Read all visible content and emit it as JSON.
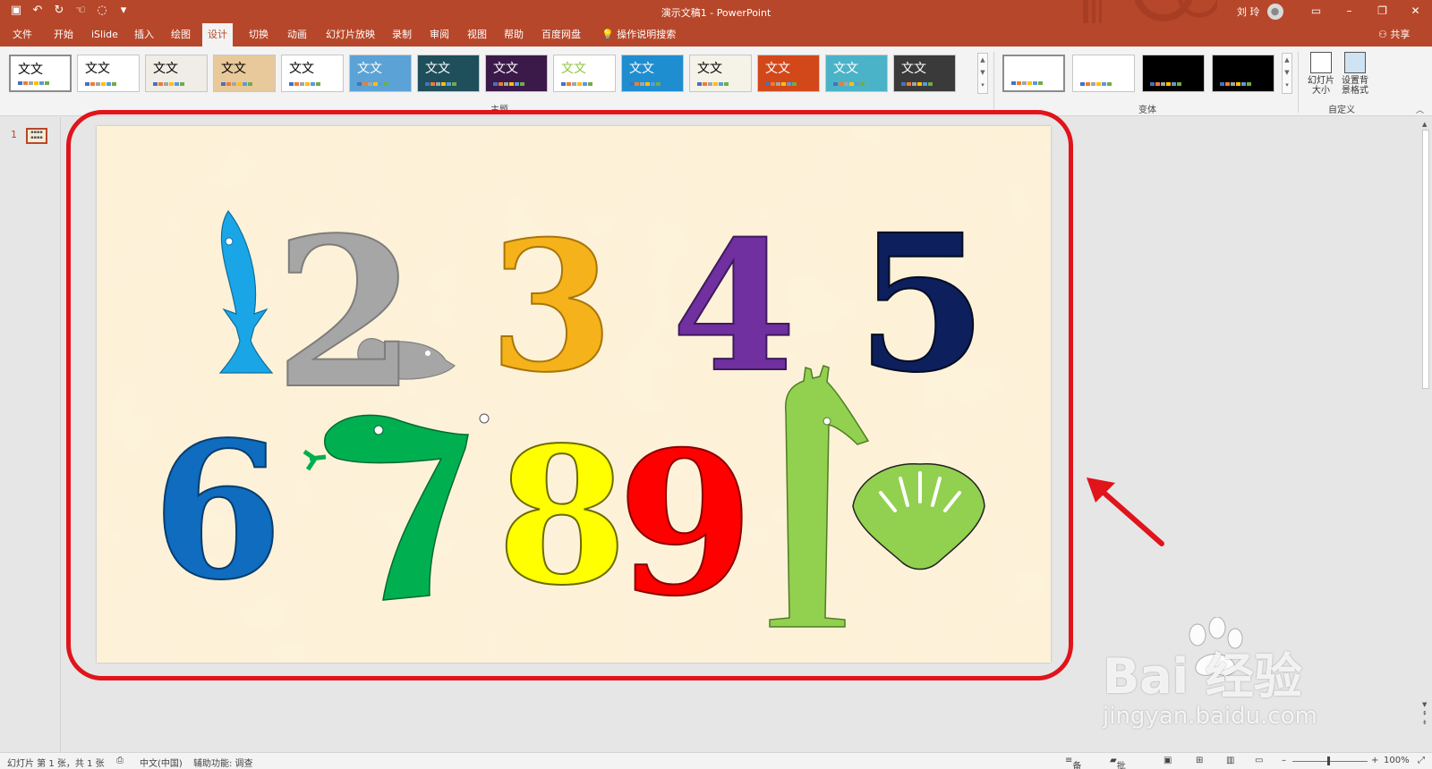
{
  "window": {
    "title": "演示文稿1  -  PowerPoint",
    "user": "刘 玲",
    "share_label": "共享"
  },
  "tabs": [
    "文件",
    "开始",
    "iSlide",
    "插入",
    "绘图",
    "设计",
    "切换",
    "动画",
    "幻灯片放映",
    "录制",
    "审阅",
    "视图",
    "帮助",
    "百度网盘",
    "操作说明搜索"
  ],
  "active_tab": "设计",
  "ribbon": {
    "theme_label": "文文",
    "themes_group_label": "主题",
    "variants_group_label": "变体",
    "customize_group_label": "自定义",
    "slide_size_label": "幻灯片大小",
    "format_bg_label": "设置背景格式"
  },
  "slides_panel": {
    "slide_number": "1"
  },
  "slide": {
    "digits": [
      "2",
      "3",
      "4",
      "5",
      "6",
      "7",
      "8",
      "9",
      "1"
    ]
  },
  "statusbar": {
    "slide_info": "幻灯片 第 1 张，共 1 张",
    "language": "中文(中国)",
    "accessibility": "辅助功能: 调查",
    "notes": "备注",
    "comments": "批注",
    "zoom": "100%"
  },
  "watermark": {
    "brand": "Bai   经验",
    "url": "jingyan.baidu.com"
  },
  "colors": {
    "accent": "#b7472a",
    "slide_bg": "#fdf1d6",
    "annotation": "#e0141b",
    "fish": "#1aa6e6",
    "digit_2": "#a6a6a6",
    "digit_3": "#f5b21a",
    "digit_4": "#7030a0",
    "digit_5": "#0d1f5c",
    "digit_6": "#0f6cbf",
    "digit_7": "#00b050",
    "digit_8": "#ffff00",
    "digit_9": "#ff0000",
    "digit_1": "#92d050",
    "shell": "#92d050"
  }
}
